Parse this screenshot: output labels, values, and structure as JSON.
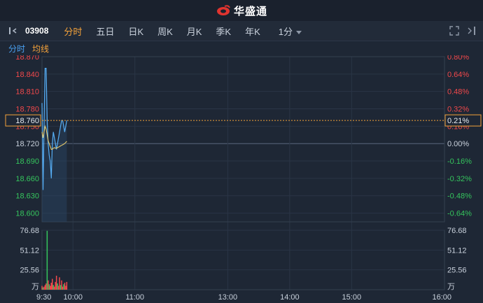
{
  "brand": {
    "name": "华盛通"
  },
  "toolbar": {
    "code": "03908",
    "periods": [
      "分时",
      "五日",
      "日K",
      "周K",
      "月K",
      "季K",
      "年K"
    ],
    "active_period": "分时",
    "interval": "1分"
  },
  "subbar": {
    "tab_time": "分时",
    "tab_avg": "均线"
  },
  "chart_data": {
    "type": "line",
    "price_axis": {
      "left_labels": [
        "18.870",
        "18.840",
        "18.810",
        "18.780",
        "18.750",
        "18.720",
        "18.690",
        "18.660",
        "18.630",
        "18.600"
      ],
      "right_labels": [
        "0.80%",
        "0.64%",
        "0.48%",
        "0.32%",
        "0.16%",
        "0.00%",
        "-0.16%",
        "-0.32%",
        "-0.48%",
        "-0.64%"
      ],
      "reference_price": 18.72,
      "ylim": [
        18.585,
        18.87
      ]
    },
    "cursor": {
      "price_label": "18.760",
      "percent_label": "0.21%",
      "price": 18.76
    },
    "volume_axis": {
      "labels": [
        "76.68",
        "51.12",
        "25.56"
      ],
      "unit": "万",
      "max": 76.68
    },
    "time_axis": {
      "labels": [
        "9:30",
        "10:00",
        "11:00",
        "13:00",
        "14:00",
        "15:00",
        "16:00"
      ]
    },
    "session_minutes": 390,
    "series": [
      {
        "name": "price",
        "color": "#56aef5",
        "minutes": [
          0,
          1,
          2,
          3,
          4,
          5,
          6,
          7,
          8,
          9,
          10,
          11,
          12,
          13,
          14,
          15,
          16,
          17,
          18,
          19,
          20,
          21,
          22,
          23,
          24
        ],
        "values": [
          18.79,
          18.64,
          18.75,
          18.85,
          18.85,
          18.76,
          18.72,
          18.7,
          18.69,
          18.66,
          18.72,
          18.74,
          18.73,
          18.72,
          18.71,
          18.72,
          18.73,
          18.74,
          18.75,
          18.76,
          18.76,
          18.75,
          18.74,
          18.75,
          18.76
        ]
      },
      {
        "name": "average",
        "color": "#e6c96a",
        "minutes": [
          0,
          1,
          2,
          3,
          4,
          5,
          6,
          7,
          8,
          9,
          10,
          11,
          12,
          13,
          14,
          15,
          16,
          17,
          18,
          19,
          20,
          21,
          22,
          23,
          24
        ],
        "values": [
          18.74,
          18.73,
          18.74,
          18.75,
          18.745,
          18.735,
          18.725,
          18.72,
          18.715,
          18.71,
          18.71,
          18.712,
          18.713,
          18.712,
          18.712,
          18.713,
          18.714,
          18.715,
          18.716,
          18.717,
          18.718,
          18.719,
          18.72,
          18.722,
          18.724
        ]
      }
    ],
    "volume": {
      "minutes": [
        0,
        1,
        2,
        3,
        4,
        5,
        6,
        7,
        8,
        9,
        10,
        11,
        12,
        13,
        14,
        15,
        16,
        17,
        18,
        19,
        20,
        21,
        22,
        23,
        24
      ],
      "values": [
        5,
        3,
        4,
        6,
        8,
        76,
        12,
        7,
        5,
        9,
        14,
        6,
        4,
        10,
        18,
        8,
        5,
        16,
        6,
        12,
        4,
        7,
        9,
        5,
        10
      ],
      "colors": [
        "r",
        "g",
        "r",
        "r",
        "r",
        "g",
        "r",
        "g",
        "r",
        "r",
        "r",
        "g",
        "r",
        "r",
        "r",
        "g",
        "r",
        "r",
        "g",
        "r",
        "r",
        "g",
        "r",
        "r",
        "r"
      ]
    }
  }
}
